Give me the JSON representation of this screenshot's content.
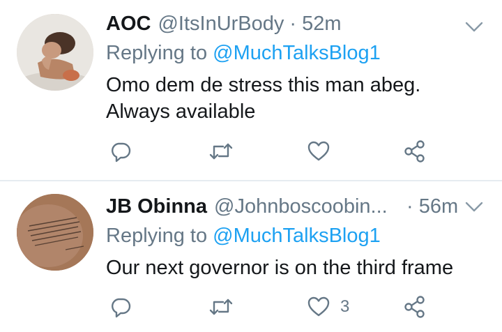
{
  "tweets": [
    {
      "name": "AOC",
      "handle": "@ItsInUrBody",
      "separator": "·",
      "time": "52m",
      "replying_prefix": "Replying to ",
      "replying_to": "@MuchTalksBlog1",
      "text_lines": [
        "Omo dem de stress this man abeg.",
        "Always available"
      ],
      "reply_count": "",
      "retweet_count": "",
      "like_count": ""
    },
    {
      "name": "JB Obinna",
      "handle": "@Johnboscoobin...",
      "separator": "·",
      "time": "56m",
      "replying_prefix": "Replying to ",
      "replying_to": "@MuchTalksBlog1",
      "text_lines": [
        "Our next governor is on the third frame"
      ],
      "reply_count": "",
      "retweet_count": "",
      "like_count": "3"
    }
  ],
  "colors": {
    "text": "#14171a",
    "secondary": "#657786",
    "link": "#1da1f2",
    "divider": "#e6ecf0",
    "icon": "#657786"
  },
  "icons": {
    "reply": "reply-icon",
    "retweet": "retweet-icon",
    "like": "heart-icon",
    "share": "share-icon",
    "menu": "chevron-down-icon"
  }
}
